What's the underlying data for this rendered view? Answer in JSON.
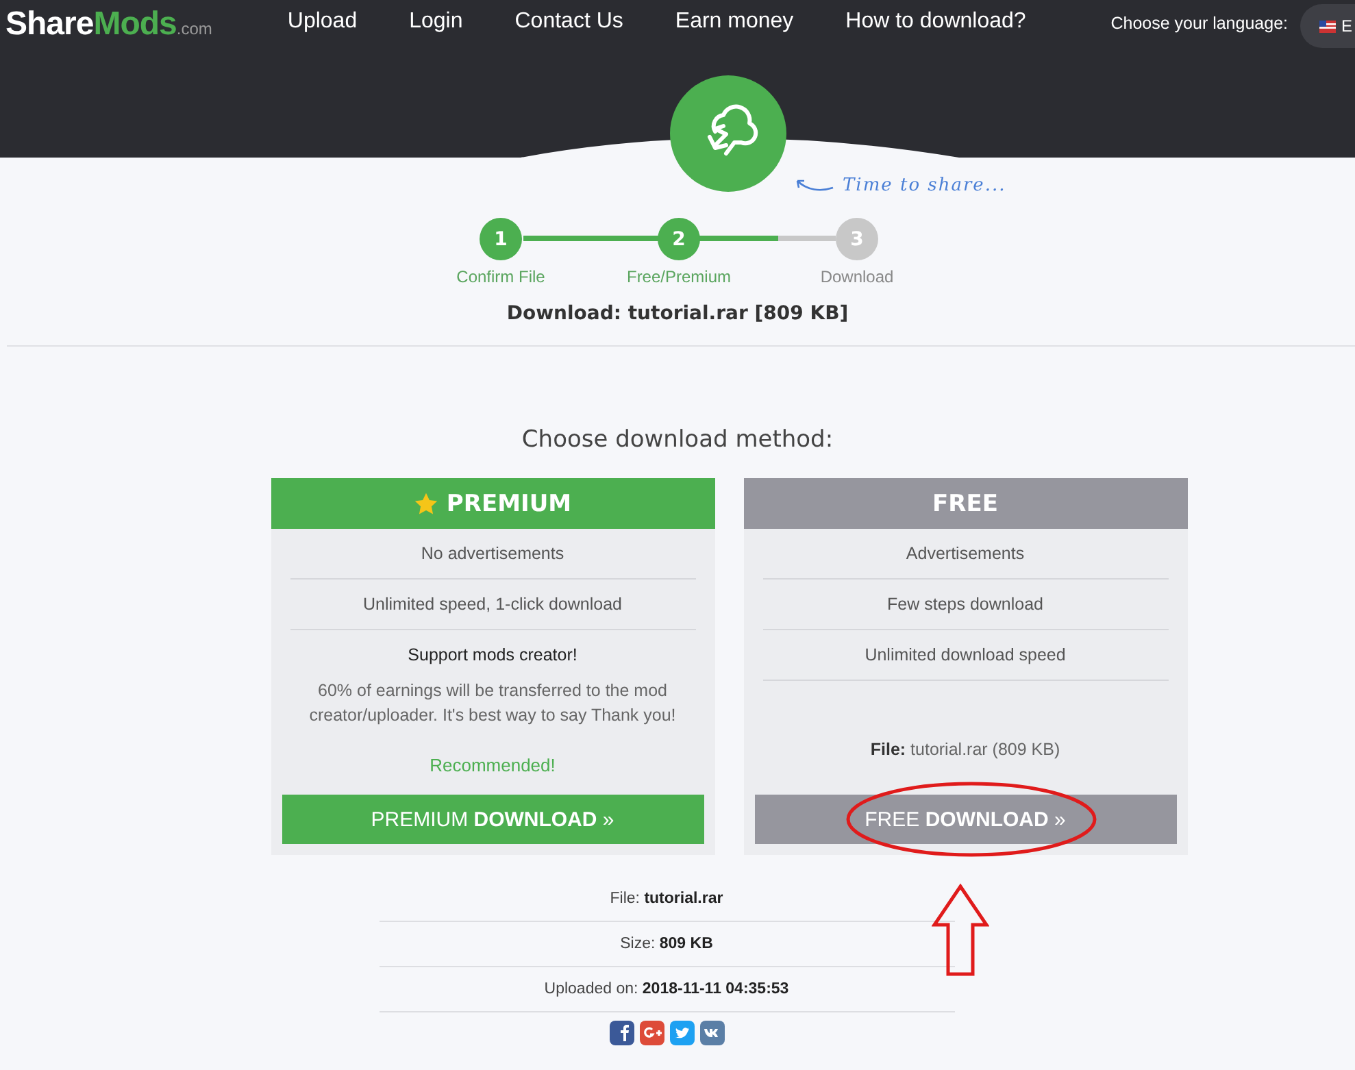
{
  "logo": {
    "parts": [
      "Share",
      "Mods",
      ".com"
    ]
  },
  "nav": [
    "Upload",
    "Login",
    "Contact Us",
    "Earn money",
    "How to download?"
  ],
  "language": {
    "label": "Choose your language:",
    "value": "E"
  },
  "tagline": "Time to share...",
  "steps": {
    "level": 0.82,
    "items": [
      {
        "number": "1",
        "label": "Confirm File",
        "completed": true
      },
      {
        "number": "2",
        "label": "Free/Premium",
        "completed": true
      },
      {
        "number": "3",
        "label": "Download",
        "completed": false
      }
    ]
  },
  "file_title": "Download: tutorial.rar [809 KB]",
  "method_title": "Choose download method:",
  "plans": [
    {
      "kind": "premium",
      "title": "PREMIUM",
      "features": [
        "No advertisements",
        "Unlimited speed, 1-click download"
      ],
      "support_title": "Support mods creator!",
      "support_text": "60% of earnings will be transferred to the mod creator/uploader. It's best way to say Thank you!",
      "recommended": "Recommended!",
      "button": "PREMIUM **DOWNLOAD** »"
    },
    {
      "kind": "free",
      "title": "FREE",
      "features": [
        "Advertisements",
        "Few steps download",
        "Unlimited download speed"
      ],
      "file_label": "File:",
      "file_value": "tutorial.rar (809 KB)",
      "button": "FREE **DOWNLOAD** »"
    }
  ],
  "info": [
    {
      "label": "File:",
      "value": "tutorial.rar"
    },
    {
      "label": "Size:",
      "value": "809 KB"
    },
    {
      "label": "Uploaded on:",
      "value": "2018-11-11 04:35:53"
    }
  ],
  "share": [
    {
      "kind": "facebook"
    },
    {
      "kind": "google"
    },
    {
      "kind": "twitter"
    },
    {
      "kind": "vk"
    }
  ]
}
